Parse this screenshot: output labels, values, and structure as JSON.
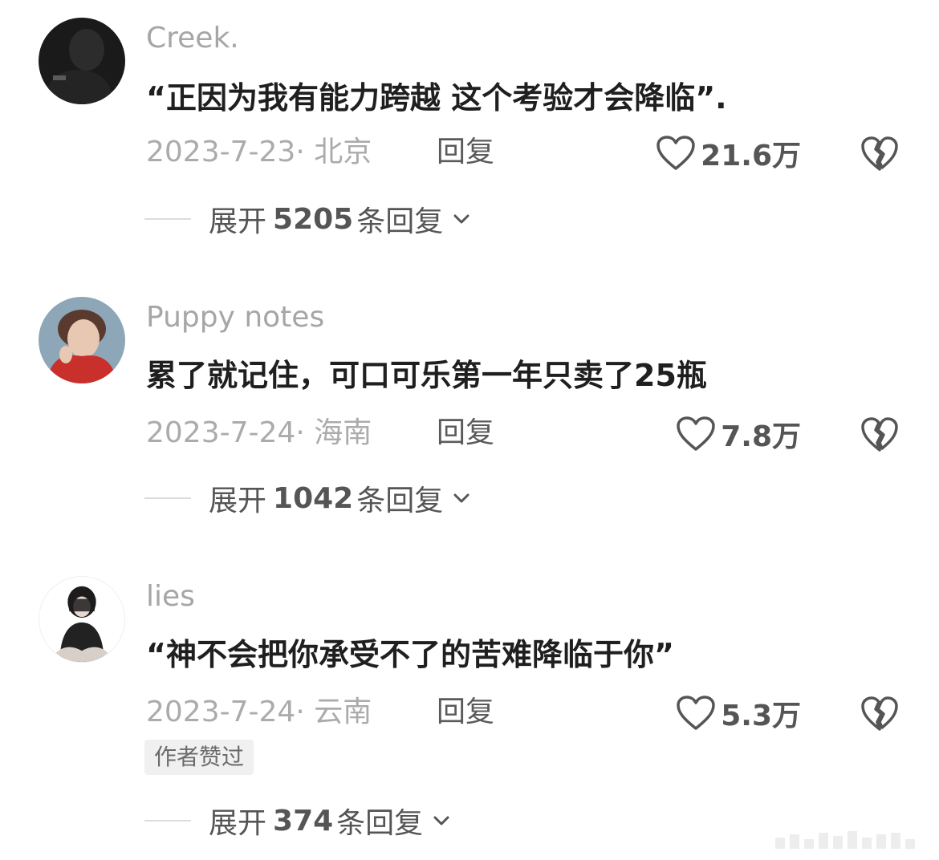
{
  "comments": [
    {
      "username": "Creek.",
      "text": "“正因为我有能力跨越 这个考验才会降临”.",
      "date": "2023-7-23",
      "location": "北京",
      "separator": "·",
      "reply_label": "回复",
      "likes": "21.6万",
      "expand_prefix": "展开",
      "expand_count": "5205",
      "expand_suffix": "条回复"
    },
    {
      "username": "Puppy notes",
      "text": "累了就记住，可口可乐第一年只卖了25瓶",
      "date": "2023-7-24",
      "location": "海南",
      "separator": "·",
      "reply_label": "回复",
      "likes": "7.8万",
      "expand_prefix": "展开",
      "expand_count": "1042",
      "expand_suffix": "条回复"
    },
    {
      "username": "lies",
      "text": "“神不会把你承受不了的苦难降临于你”",
      "date": "2023-7-24",
      "location": "云南",
      "separator": "·",
      "reply_label": "回复",
      "likes": "5.3万",
      "badge": "作者赞过",
      "expand_prefix": "展开",
      "expand_count": "374",
      "expand_suffix": "条回复"
    }
  ],
  "icons": {
    "like": "heart-outline-icon",
    "dislike": "broken-heart-icon",
    "expand": "chevron-down-icon"
  },
  "colors": {
    "text": "#1f1f1f",
    "muted": "#ababab",
    "secondary": "#555555",
    "badge_bg": "#f0f0f0"
  }
}
